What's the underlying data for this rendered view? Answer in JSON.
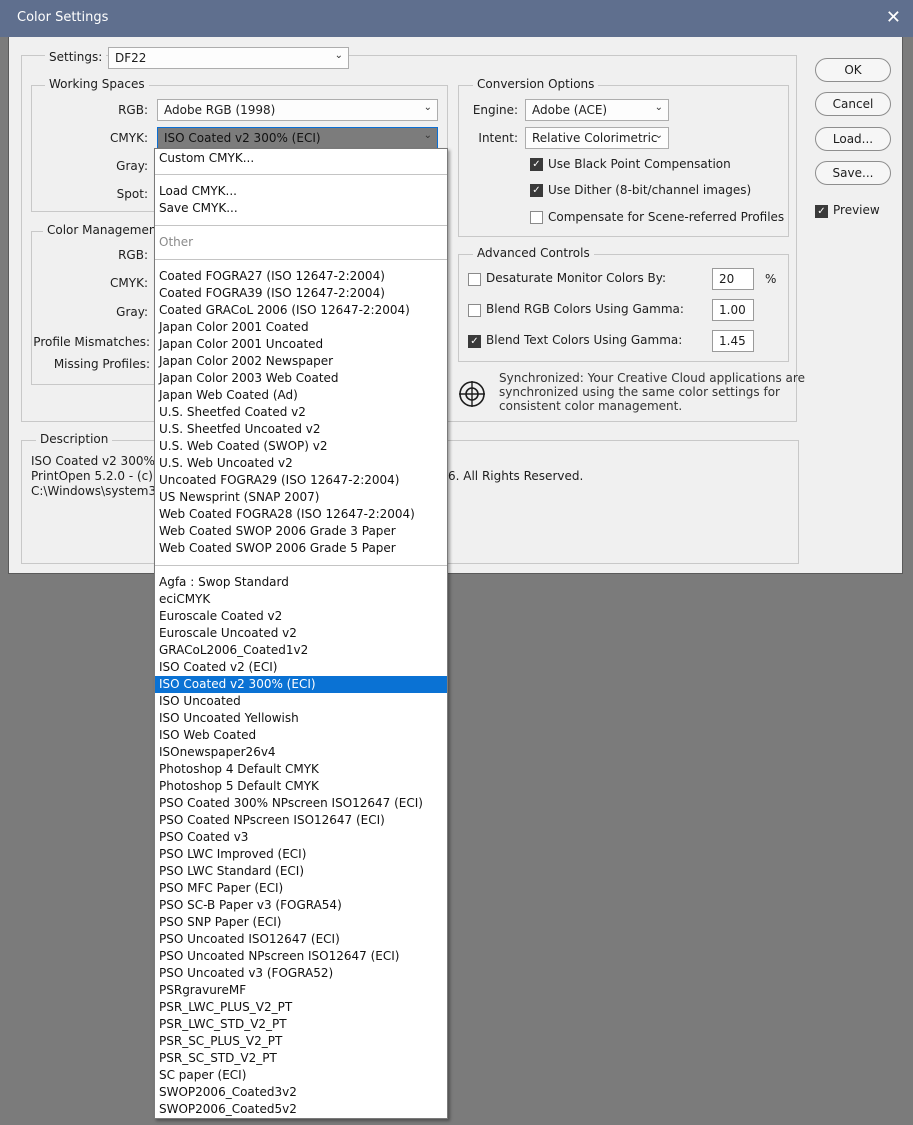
{
  "window": {
    "title": "Color Settings",
    "close_glyph": "✕"
  },
  "settings": {
    "label": "Settings:",
    "value": "DF22"
  },
  "working_spaces": {
    "title": "Working Spaces",
    "rgb_label": "RGB:",
    "rgb_value": "Adobe RGB (1998)",
    "cmyk_label": "CMYK:",
    "cmyk_value": "ISO Coated v2 300% (ECI)",
    "gray_label": "Gray:",
    "spot_label": "Spot:"
  },
  "color_management": {
    "title": "Color Managemen",
    "rgb_label": "RGB:",
    "cmyk_label": "CMYK:",
    "gray_label": "Gray:",
    "mismatch_label": "Profile Mismatches:",
    "missing_label": "Missing Profiles:"
  },
  "conversion": {
    "title": "Conversion Options",
    "engine_label": "Engine:",
    "engine_value": "Adobe (ACE)",
    "intent_label": "Intent:",
    "intent_value": "Relative Colorimetric",
    "bpc_label": "Use Black Point Compensation",
    "bpc_checked": true,
    "dither_label": "Use Dither (8-bit/channel images)",
    "dither_checked": true,
    "scene_label": "Compensate for Scene-referred Profiles",
    "scene_checked": false
  },
  "advanced": {
    "title": "Advanced Controls",
    "desaturate_label": "Desaturate Monitor Colors By:",
    "desaturate_value": "20",
    "desaturate_unit": "%",
    "desaturate_checked": false,
    "blend_rgb_label": "Blend RGB Colors Using Gamma:",
    "blend_rgb_value": "1.00",
    "blend_rgb_checked": false,
    "blend_text_label": "Blend Text Colors Using Gamma:",
    "blend_text_value": "1.45",
    "blend_text_checked": true
  },
  "sync": {
    "line1": "Synchronized: Your Creative Cloud applications are",
    "line2": "synchronized using the same color settings for",
    "line3": "consistent color management."
  },
  "description": {
    "title": "Description",
    "line1": "ISO Coated v2 300% (",
    "line2": "PrintOpen 5.2.0 - (c) C",
    "line2_tail": "6. All Rights Reserved.",
    "line3": "C:\\Windows\\system32"
  },
  "buttons": {
    "ok": "OK",
    "cancel": "Cancel",
    "load": "Load...",
    "save": "Save...",
    "preview": "Preview",
    "preview_checked": true
  },
  "menu": {
    "top": [
      "Custom CMYK..."
    ],
    "load_save": [
      "Load CMYK...",
      "Save CMYK..."
    ],
    "other_header": "Other",
    "standard": [
      "Coated FOGRA27 (ISO 12647-2:2004)",
      "Coated FOGRA39 (ISO 12647-2:2004)",
      "Coated GRACoL 2006 (ISO 12647-2:2004)",
      "Japan Color 2001 Coated",
      "Japan Color 2001 Uncoated",
      "Japan Color 2002 Newspaper",
      "Japan Color 2003 Web Coated",
      "Japan Web Coated (Ad)",
      "U.S. Sheetfed Coated v2",
      "U.S. Sheetfed Uncoated v2",
      "U.S. Web Coated (SWOP) v2",
      "U.S. Web Uncoated v2",
      "Uncoated FOGRA29 (ISO 12647-2:2004)",
      "US Newsprint (SNAP 2007)",
      "Web Coated FOGRA28 (ISO 12647-2:2004)",
      "Web Coated SWOP 2006 Grade 3 Paper",
      "Web Coated SWOP 2006 Grade 5 Paper"
    ],
    "custom": [
      "Agfa : Swop Standard",
      "eciCMYK",
      "Euroscale Coated v2",
      "Euroscale Uncoated v2",
      "GRACoL2006_Coated1v2",
      "ISO Coated v2 (ECI)",
      "ISO Coated v2 300% (ECI)",
      "ISO Uncoated",
      "ISO Uncoated Yellowish",
      "ISO Web Coated",
      "ISOnewspaper26v4",
      "Photoshop 4 Default CMYK",
      "Photoshop 5 Default CMYK",
      "PSO Coated 300% NPscreen ISO12647 (ECI)",
      "PSO Coated NPscreen ISO12647 (ECI)",
      "PSO Coated v3",
      "PSO LWC Improved (ECI)",
      "PSO LWC Standard (ECI)",
      "PSO MFC Paper (ECI)",
      "PSO SC-B Paper v3 (FOGRA54)",
      "PSO SNP Paper (ECI)",
      "PSO Uncoated ISO12647 (ECI)",
      "PSO Uncoated NPscreen ISO12647 (ECI)",
      "PSO Uncoated v3 (FOGRA52)",
      "PSRgravureMF",
      "PSR_LWC_PLUS_V2_PT",
      "PSR_LWC_STD_V2_PT",
      "PSR_SC_PLUS_V2_PT",
      "PSR_SC_STD_V2_PT",
      "SC paper (ECI)",
      "SWOP2006_Coated3v2",
      "SWOP2006_Coated5v2"
    ],
    "selected": "ISO Coated v2 300% (ECI)"
  },
  "colors": {
    "selection": "#0a72d4",
    "titlebar": "#5f6f8e",
    "dialog_bg": "#f0f0f0",
    "backdrop": "#7b7b7b"
  }
}
